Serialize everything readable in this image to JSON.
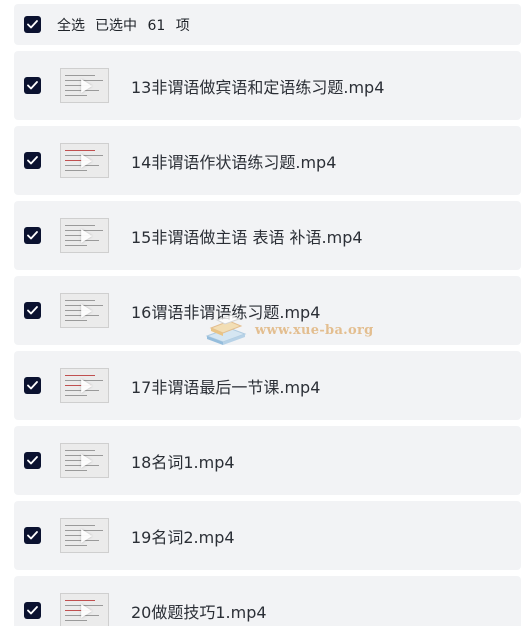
{
  "header": {
    "select_all_label": "全选",
    "selected_prefix": "已选中",
    "selected_count": "61",
    "selected_suffix": "项"
  },
  "files": [
    {
      "name": "13非谓语做宾语和定语练习题.mp4",
      "checked": true
    },
    {
      "name": "14非谓语作状语练习题.mp4",
      "checked": true
    },
    {
      "name": "15非谓语做主语 表语 补语.mp4",
      "checked": true
    },
    {
      "name": "16谓语非谓语练习题.mp4",
      "checked": true
    },
    {
      "name": "17非谓语最后一节课.mp4",
      "checked": true
    },
    {
      "name": "18名词1.mp4",
      "checked": true
    },
    {
      "name": "19名词2.mp4",
      "checked": true
    },
    {
      "name": "20做题技巧1.mp4",
      "checked": true
    }
  ],
  "watermark": {
    "text": "www.xue-ba.org"
  },
  "colors": {
    "checkbox": "#0b1230",
    "row_background": "#f2f3f5",
    "text": "#2b2f36",
    "watermark": "#e0b277"
  },
  "icons": {
    "checkbox": "checkmark-icon",
    "thumbnail": "video-play-icon"
  }
}
